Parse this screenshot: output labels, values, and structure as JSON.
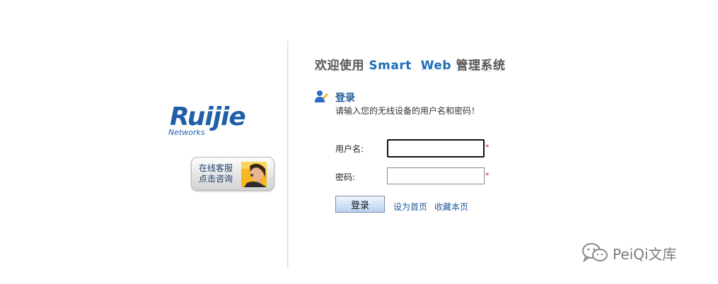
{
  "header": {
    "title_prefix": "欢迎使用",
    "title_accent": "Smart  Web",
    "title_suffix": "管理系统"
  },
  "brand": {
    "logo_text": "Ruijie",
    "logo_subtext": "Networks",
    "logo_color": "#1f5fa8"
  },
  "service": {
    "line1": "在线客服",
    "line2": "点击咨询"
  },
  "login": {
    "heading": "登录",
    "subtitle": "请输入您的无线设备的用户名和密码！",
    "username_label": "用户名:",
    "username_value": "",
    "password_label": "密码:",
    "password_value": "",
    "required_mark": "*",
    "submit_label": "登录",
    "set_homepage": "设为首页",
    "bookmark": "收藏本页"
  },
  "watermark": {
    "text": "PeiQi文库",
    "icon": "wechat-icon"
  },
  "colors": {
    "accent": "#1e6db8",
    "link": "#1e5a96",
    "required": "#e02020"
  }
}
